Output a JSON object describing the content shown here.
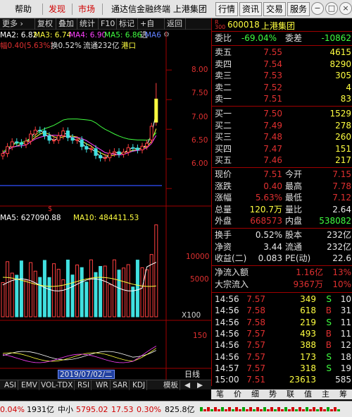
{
  "menubar": {
    "items": [
      {
        "label": "帮助",
        "style": "normal"
      },
      {
        "label": "发现",
        "style": "red"
      },
      {
        "label": "市场",
        "style": "red"
      }
    ],
    "title": "通达信金融终端 上港集团",
    "buttons": [
      "行情",
      "资讯",
      "交易",
      "服务"
    ],
    "controls": [
      "−",
      "□",
      "×"
    ]
  },
  "chart_toolbar": {
    "left_text": "更多 ›",
    "buttons": [
      "复权",
      "叠加",
      "统计",
      "F10",
      "标记",
      "+自选",
      "返回"
    ]
  },
  "ma_labels": {
    "ma2": "MA2: 6.82",
    "ma3": "MA3: 6.74",
    "ma4": "MA4: 6.90",
    "ma5": "MA5: 6.86",
    "ma6": "MA6"
  },
  "info_line": {
    "prefix": "幅0.40(5.63%)",
    "turnover": "换0.52%",
    "float": "流通232亿",
    "sector": "港口"
  },
  "price_axis": [
    "8.00",
    "7.50",
    "7.00",
    "6.50",
    "6.00"
  ],
  "volume_labels": {
    "ma5": "MA5: 627090.88",
    "ma10": "MA10: 484411.53",
    "axis": [
      "10000",
      "5000"
    ],
    "unit": "X100"
  },
  "indicator_axis": [
    "150"
  ],
  "date_label": "2019/07/02/二",
  "period_button": "日线",
  "indicator_tabs": [
    "ASI",
    "EMV",
    "VOL-TDX",
    "RSI",
    "WR",
    "SAR",
    "KDJ",
    "模板"
  ],
  "chart_data": {
    "type": "candlestick",
    "series": [
      {
        "name": "MA2",
        "color": "#ffffff"
      },
      {
        "name": "MA3",
        "color": "#ffff40"
      },
      {
        "name": "MA4",
        "color": "#ff40ff"
      },
      {
        "name": "MA5",
        "color": "#40ff40"
      }
    ],
    "price_ylim": [
      5.8,
      8.3
    ],
    "last_close": 7.51,
    "last_volume_bar": 12100,
    "volume_ylim": [
      0,
      13000
    ]
  },
  "quote": {
    "code": "600018",
    "name": "上港集团",
    "weibi_label": "委比",
    "weibi_value": "-69.04%",
    "weicha_label": "委差",
    "weicha_value": "-10862",
    "asks": [
      {
        "label": "卖五",
        "price": "7.55",
        "vol": "4615"
      },
      {
        "label": "卖四",
        "price": "7.54",
        "vol": "8290"
      },
      {
        "label": "卖三",
        "price": "7.53",
        "vol": "305"
      },
      {
        "label": "卖二",
        "price": "7.52",
        "vol": "4"
      },
      {
        "label": "卖一",
        "price": "7.51",
        "vol": "83"
      }
    ],
    "bids": [
      {
        "label": "买一",
        "price": "7.50",
        "vol": "1529"
      },
      {
        "label": "买二",
        "price": "7.49",
        "vol": "278"
      },
      {
        "label": "买三",
        "price": "7.48",
        "vol": "260"
      },
      {
        "label": "买四",
        "price": "7.47",
        "vol": "151"
      },
      {
        "label": "买五",
        "price": "7.46",
        "vol": "217"
      }
    ],
    "stats": [
      {
        "l1": "现价",
        "v1": "7.51",
        "l2": "今开",
        "v2": "7.15"
      },
      {
        "l1": "涨跌",
        "v1": "0.40",
        "l2": "最高",
        "v2": "7.78"
      },
      {
        "l1": "涨幅",
        "v1": "5.63%",
        "l2": "最低",
        "v2": "7.12"
      },
      {
        "l1": "总量",
        "v1": "120.7万",
        "l2": "量比",
        "v2": "2.64"
      },
      {
        "l1": "外盘",
        "v1": "668573",
        "l2": "内盘",
        "v2": "538082"
      }
    ],
    "stats2": [
      {
        "l1": "换手",
        "v1": "0.52%",
        "l2": "股本",
        "v2": "232亿"
      },
      {
        "l1": "净资",
        "v1": "3.44",
        "l2": "流通",
        "v2": "232亿"
      },
      {
        "l1": "收益(二)",
        "v1": "0.083",
        "l2": "PE(动)",
        "v2": "22.6"
      }
    ],
    "flows": [
      {
        "label": "净流入额",
        "value": "1.16亿",
        "pct": "13%"
      },
      {
        "label": "大宗流入",
        "value": "9367万",
        "pct": "10%"
      }
    ],
    "ticks": [
      {
        "time": "14:56",
        "price": "7.57",
        "vol": "349",
        "dir": "S",
        "n": "10"
      },
      {
        "time": "14:56",
        "price": "7.58",
        "vol": "618",
        "dir": "B",
        "n": "31"
      },
      {
        "time": "14:56",
        "price": "7.58",
        "vol": "219",
        "dir": "S",
        "n": "11"
      },
      {
        "time": "14:56",
        "price": "7.57",
        "vol": "493",
        "dir": "B",
        "n": "11"
      },
      {
        "time": "14:56",
        "price": "7.57",
        "vol": "388",
        "dir": "B",
        "n": "12"
      },
      {
        "time": "14:56",
        "price": "7.57",
        "vol": "173",
        "dir": "S",
        "n": "18"
      },
      {
        "time": "14:57",
        "price": "7.57",
        "vol": "318",
        "dir": "S",
        "n": "19"
      },
      {
        "time": "15:00",
        "price": "7.51",
        "vol": "23613",
        "dir": "",
        "n": "585"
      }
    ],
    "tabs": [
      "笔",
      "价",
      "细",
      "势",
      "联",
      "值",
      "主",
      "筹"
    ]
  },
  "statusbar": {
    "seg1_pct": "0.04%",
    "seg1_amt": "1931亿",
    "index_name": "中小",
    "index_value": "5795.02",
    "index_change": "17.53",
    "index_pct": "0.30%",
    "index_amt": "825.8亿"
  }
}
